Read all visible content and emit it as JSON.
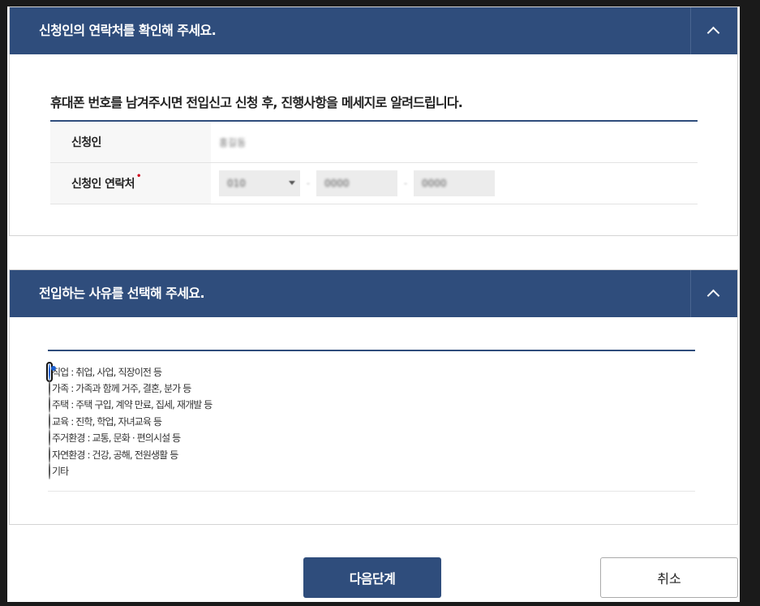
{
  "contact_section": {
    "title": "신청인의 연락처를 확인해 주세요.",
    "toggle_icon": "chevron-up-icon",
    "intro": "휴대폰 번호를 남겨주시면 전입신고 신청 후, 진행사항을 메세지로 알려드립니다.",
    "applicant_label": "신청인",
    "applicant_value": "홍길동",
    "phone_label": "신청인 연락처",
    "required_mark": "•",
    "phone_prefix": "010",
    "phone_middle": "0000",
    "phone_last": "0000",
    "phone_separator": "-"
  },
  "reason_section": {
    "title": "전입하는 사유를 선택해 주세요.",
    "toggle_icon": "chevron-up-icon",
    "options": [
      {
        "label": "직업 : 취업, 사업, 직장이전 등",
        "checked": true
      },
      {
        "label": "가족 : 가족과 함께 거주, 결혼, 분가 등",
        "checked": false
      },
      {
        "label": "주택 : 주택 구입, 계약 만료, 집세, 재개발 등",
        "checked": false
      },
      {
        "label": "교육 : 진학, 학업, 자녀교육 등",
        "checked": false
      },
      {
        "label": "주거환경 : 교통, 문화 · 편의시설 등",
        "checked": false
      },
      {
        "label": "자연환경 : 건강, 공해, 전원생활 등",
        "checked": false
      },
      {
        "label": "기타",
        "checked": false
      }
    ]
  },
  "actions": {
    "next_label": "다음단계",
    "cancel_label": "취소"
  },
  "colors": {
    "header_bg": "#2f4d7c",
    "required": "#d0021b"
  }
}
